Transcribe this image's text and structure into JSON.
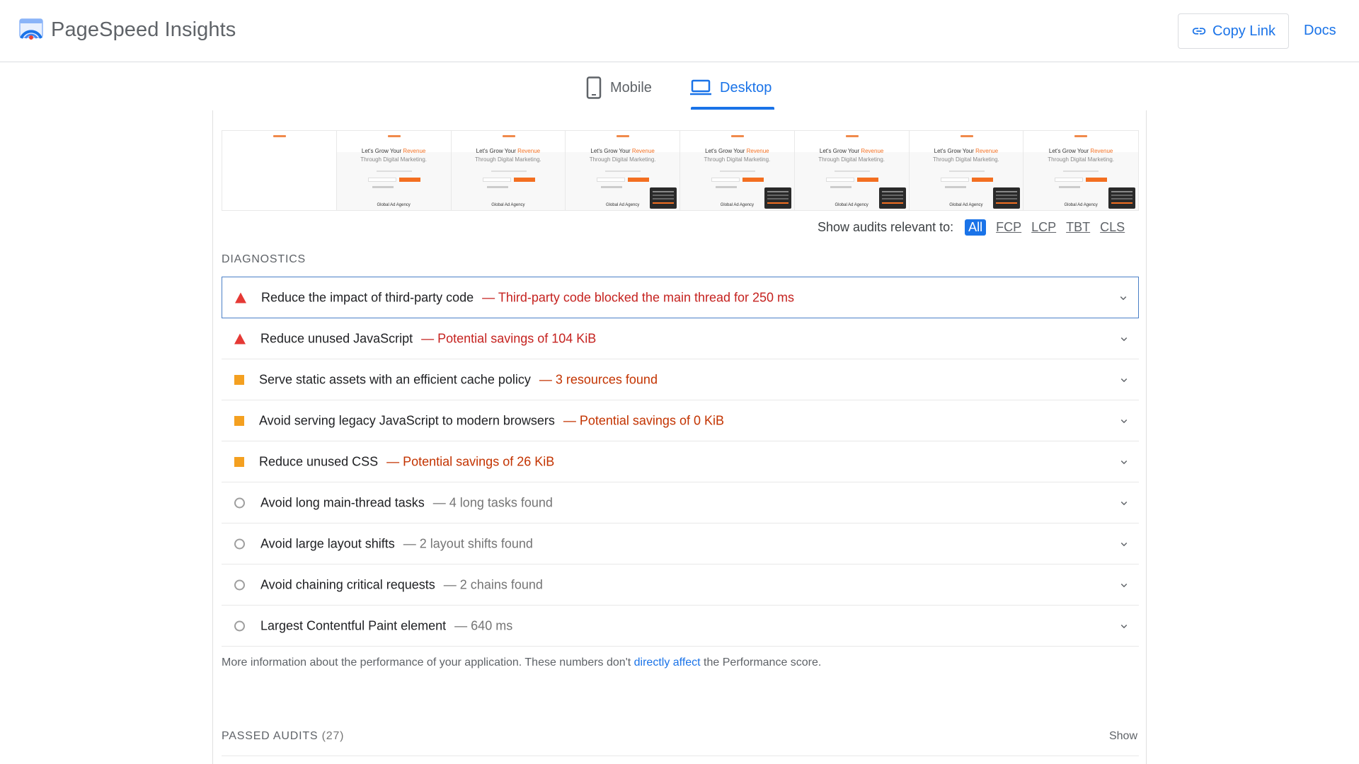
{
  "header": {
    "app_title": "PageSpeed Insights",
    "copy_link_label": "Copy Link",
    "docs_label": "Docs"
  },
  "tabs": [
    {
      "label": "Mobile",
      "icon": "phone-icon",
      "active": false
    },
    {
      "label": "Desktop",
      "icon": "laptop-icon",
      "active": true
    }
  ],
  "filmstrip": {
    "frame_headline": "Let's Grow Your ",
    "frame_headline_accent": "Revenue",
    "frame_subline": "Through Digital Marketing.",
    "frame_footer": "Global Ad Agency",
    "frame_count": 8
  },
  "filter": {
    "label": "Show audits relevant to:",
    "options": [
      "All",
      "FCP",
      "LCP",
      "TBT",
      "CLS"
    ],
    "selected": "All"
  },
  "diagnostics": {
    "title": "DIAGNOSTICS",
    "audits": [
      {
        "title": "Reduce the impact of third-party code",
        "display": "— Third-party code blocked the main thread for 250 ms",
        "severity": "fail"
      },
      {
        "title": "Reduce unused JavaScript",
        "display": "— Potential savings of 104 KiB",
        "severity": "fail"
      },
      {
        "title": "Serve static assets with an efficient cache policy",
        "display": "— 3 resources found",
        "severity": "average"
      },
      {
        "title": "Avoid serving legacy JavaScript to modern browsers",
        "display": "— Potential savings of 0 KiB",
        "severity": "average"
      },
      {
        "title": "Reduce unused CSS",
        "display": "— Potential savings of 26 KiB",
        "severity": "average"
      },
      {
        "title": "Avoid long main-thread tasks",
        "display": "— 4 long tasks found",
        "severity": "info"
      },
      {
        "title": "Avoid large layout shifts",
        "display": "— 2 layout shifts found",
        "severity": "info"
      },
      {
        "title": "Avoid chaining critical requests",
        "display": "— 2 chains found",
        "severity": "info"
      },
      {
        "title": "Largest Contentful Paint element",
        "display": "— 640 ms",
        "severity": "info"
      }
    ],
    "more_info_prefix": "More information about the performance of your application. These numbers don't ",
    "more_info_link": "directly affect",
    "more_info_suffix": " the Performance score."
  },
  "passed_audits": {
    "title": "PASSED AUDITS",
    "count": "(27)",
    "show_label": "Show"
  },
  "colors": {
    "accent": "#1a73e8",
    "fail": "#e53935",
    "average": "#f4a020",
    "fail_text": "#c5221f",
    "average_text": "#c33300"
  }
}
